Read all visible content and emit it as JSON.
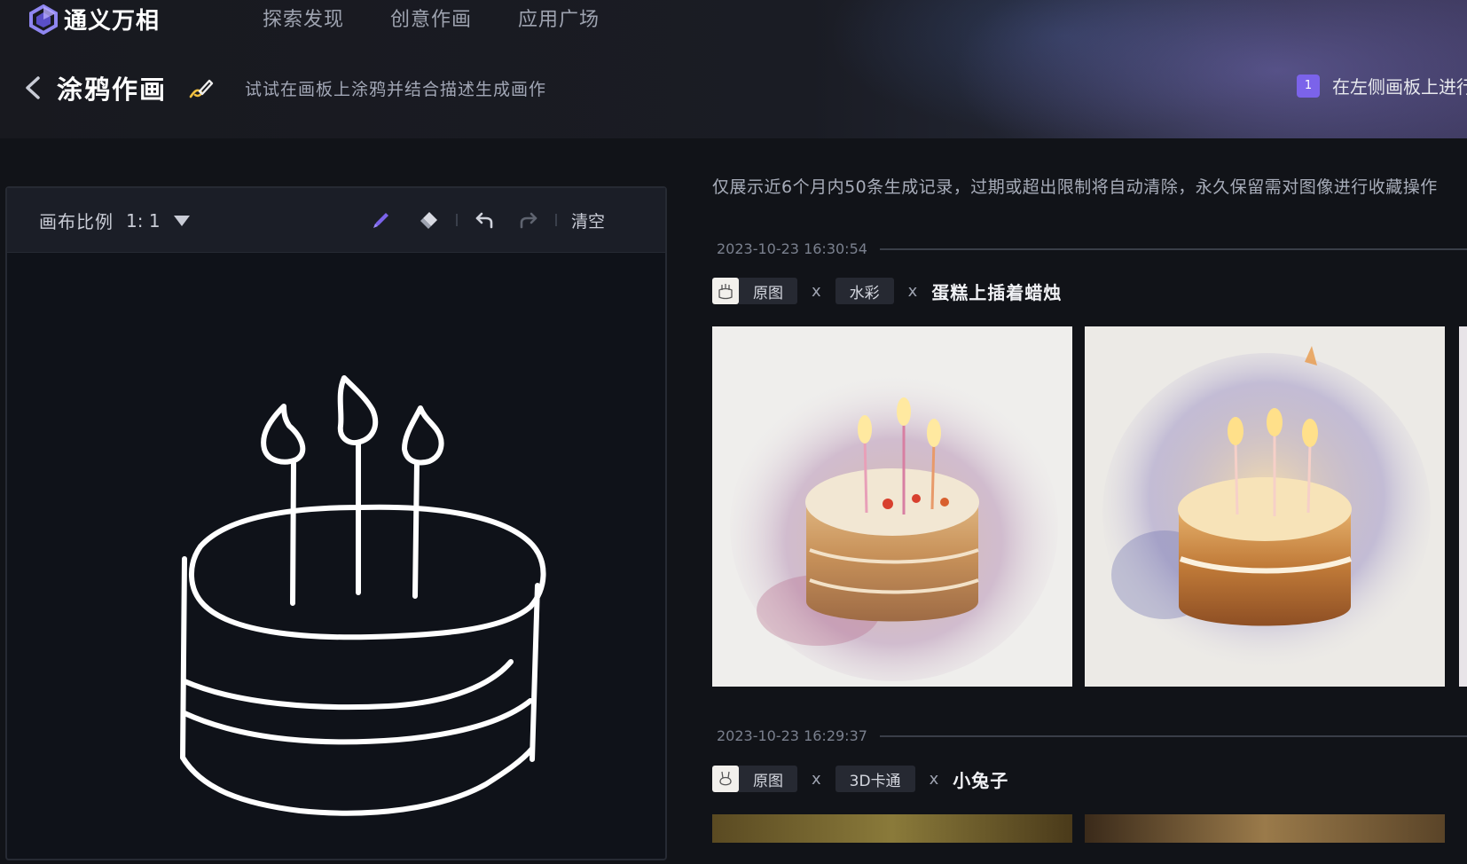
{
  "app": {
    "name": "通义万相"
  },
  "nav": {
    "items": [
      "探索发现",
      "创意作画",
      "应用广场"
    ]
  },
  "subheader": {
    "title": "涂鸦作画",
    "subtitle": "试试在画板上涂鸦并结合描述生成画作",
    "step_number": "1",
    "step_text": "在左侧画板上进行"
  },
  "canvas": {
    "ratio_label": "画布比例",
    "ratio_value": "1: 1",
    "clear_label": "清空"
  },
  "history": {
    "notice": "仅展示近6个月内50条生成记录，过期或超出限制将自动清除，永久保留需对图像进行收藏操作",
    "records": [
      {
        "time": "2023-10-23 16:30:54",
        "orig_label": "原图",
        "times_1": "x",
        "style": "水彩",
        "times_2": "x",
        "prompt": "蛋糕上插着蜡烛"
      },
      {
        "time": "2023-10-23 16:29:37",
        "orig_label": "原图",
        "times_1": "x",
        "style": "3D卡通",
        "times_2": "x",
        "prompt": "小兔子"
      }
    ]
  },
  "colors": {
    "accent": "#7b63ea",
    "background": "#111318"
  },
  "icons": [
    "logo-icon",
    "back-icon",
    "pen-icon",
    "dropdown-icon",
    "brush-icon",
    "eraser-icon",
    "undo-icon",
    "redo-icon"
  ]
}
